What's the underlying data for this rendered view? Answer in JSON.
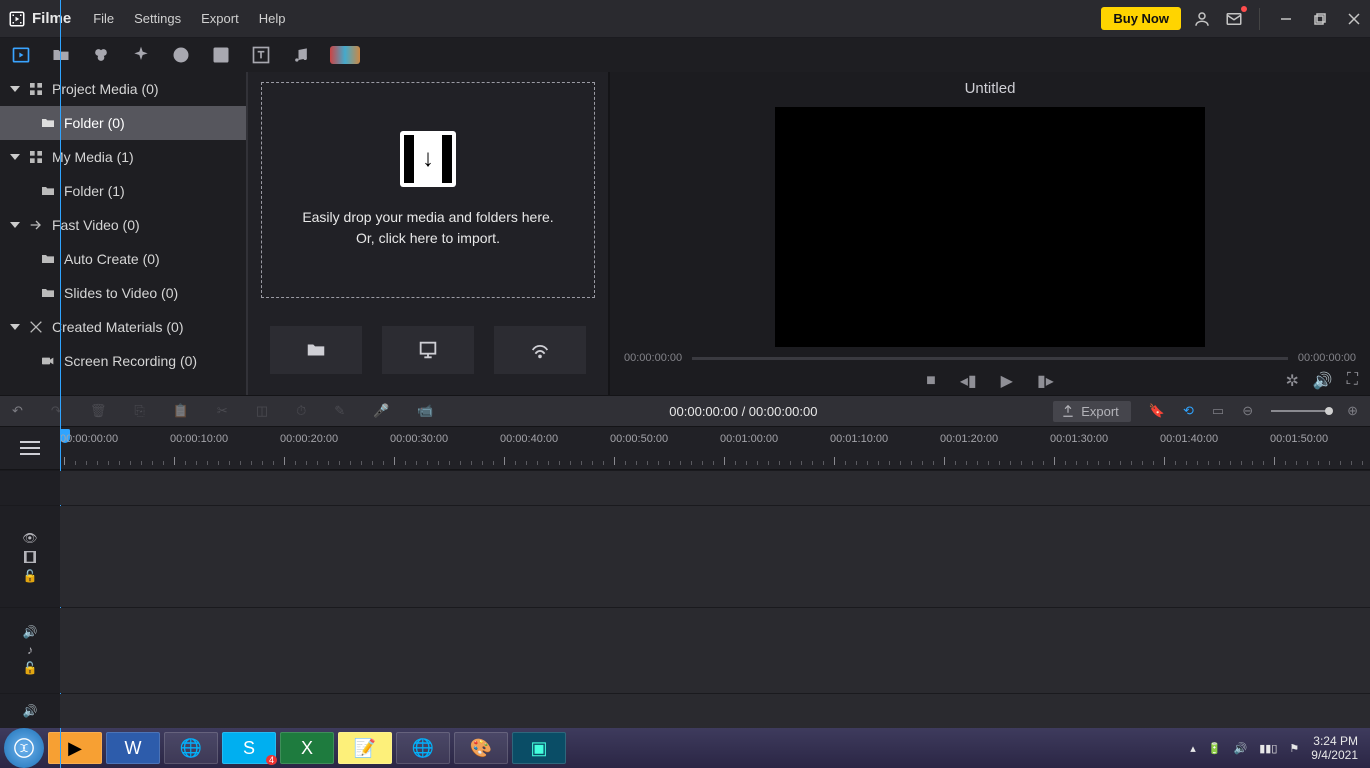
{
  "app": {
    "name": "Filme"
  },
  "menu": [
    "File",
    "Settings",
    "Export",
    "Help"
  ],
  "titlebar": {
    "buynow": "Buy Now"
  },
  "sidebar": {
    "items": [
      {
        "label": "Project Media (0)",
        "icon": "grid",
        "expandable": true
      },
      {
        "label": "Folder (0)",
        "icon": "folder",
        "child": true,
        "selected": true
      },
      {
        "label": "My Media (1)",
        "icon": "grid",
        "expandable": true
      },
      {
        "label": "Folder (1)",
        "icon": "folder",
        "child": true
      },
      {
        "label": "Fast Video (0)",
        "icon": "arrow",
        "expandable": true
      },
      {
        "label": "Auto Create (0)",
        "icon": "folder",
        "child": true
      },
      {
        "label": "Slides to Video (0)",
        "icon": "folder",
        "child": true
      },
      {
        "label": "Created Materials (0)",
        "icon": "pattern",
        "expandable": true
      },
      {
        "label": "Screen Recording (0)",
        "icon": "cam",
        "child": true
      }
    ]
  },
  "dropzone": {
    "line1": "Easily drop your media and folders here.",
    "line2": "Or, click here to import."
  },
  "preview": {
    "title": "Untitled",
    "time_left": "00:00:00:00",
    "time_right": "00:00:00:00"
  },
  "editbar": {
    "center": "00:00:00:00 / 00:00:00:00",
    "export": "Export"
  },
  "ruler": {
    "marks": [
      "00:00:00:00",
      "00:00:10:00",
      "00:00:20:00",
      "00:00:30:00",
      "00:00:40:00",
      "00:00:50:00",
      "00:01:00:00",
      "00:01:10:00",
      "00:01:20:00",
      "00:01:30:00",
      "00:01:40:00",
      "00:01:50:00"
    ]
  },
  "tray": {
    "time": "3:24 PM",
    "date": "9/4/2021"
  }
}
